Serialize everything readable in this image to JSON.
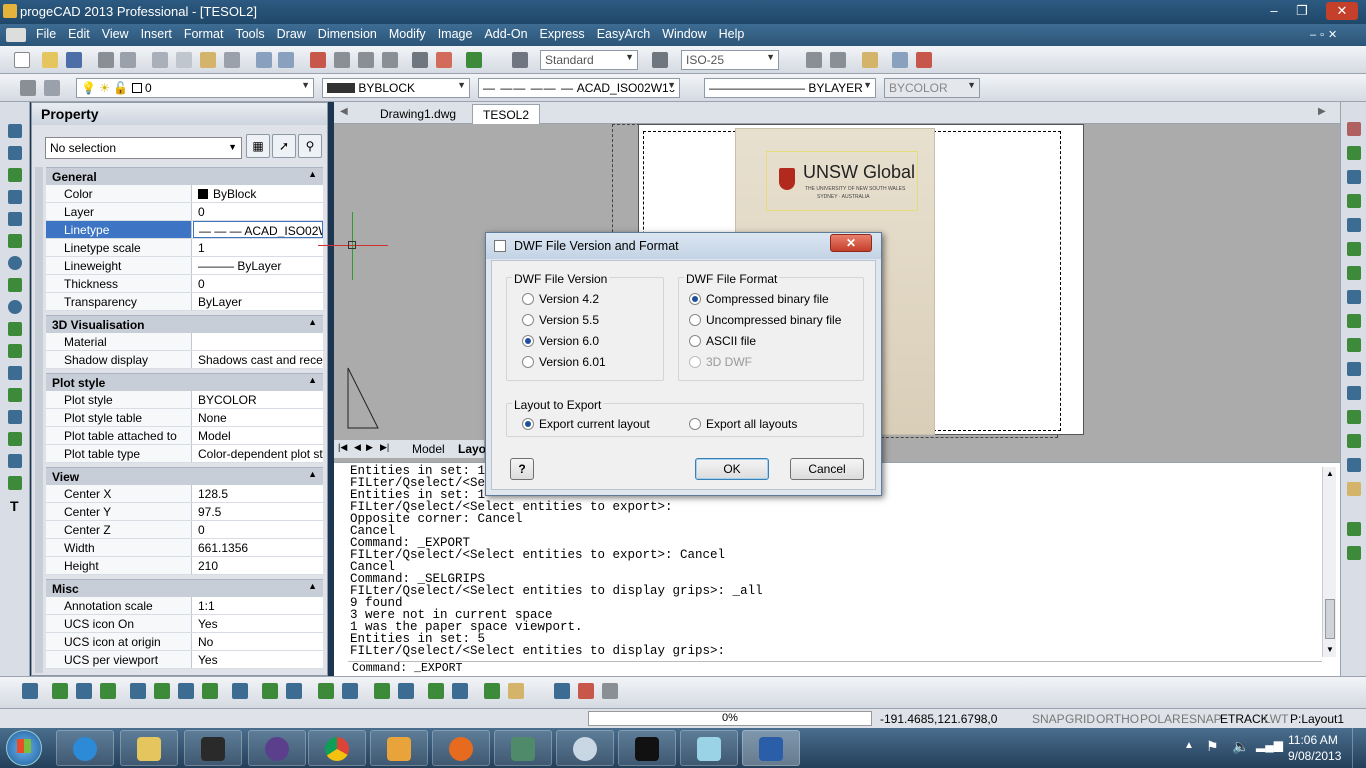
{
  "window": {
    "title": "progeCAD 2013 Professional - [TESOL2]",
    "min": "–",
    "restore": "❐",
    "close": "✕"
  },
  "menu": [
    "File",
    "Edit",
    "View",
    "Insert",
    "Format",
    "Tools",
    "Draw",
    "Dimension",
    "Modify",
    "Image",
    "Add-On",
    "Express",
    "EasyArch",
    "Window",
    "Help"
  ],
  "toolbar": {
    "text_style": "Standard",
    "dim_style": "ISO-25"
  },
  "layer_bar": {
    "layer": "0",
    "color": "BYBLOCK",
    "linetype": "ACAD_ISO02W10",
    "lineweight": "BYLAYER",
    "plotstyle": "BYCOLOR"
  },
  "property": {
    "title": "Property",
    "selection": "No selection",
    "groups": [
      {
        "name": "General",
        "rows": [
          [
            "Color",
            "ByBlock"
          ],
          [
            "Layer",
            "0"
          ],
          [
            "Linetype",
            "ACAD_ISO02W..."
          ],
          [
            "Linetype scale",
            "1"
          ],
          [
            "Lineweight",
            "ByLayer"
          ],
          [
            "Thickness",
            "0"
          ],
          [
            "Transparency",
            "ByLayer"
          ]
        ]
      },
      {
        "name": "3D Visualisation",
        "rows": [
          [
            "Material",
            ""
          ],
          [
            "Shadow display",
            "Shadows cast and recei..."
          ]
        ]
      },
      {
        "name": "Plot style",
        "rows": [
          [
            "Plot style",
            "BYCOLOR"
          ],
          [
            "Plot style table",
            "None"
          ],
          [
            "Plot table attached to",
            "Model"
          ],
          [
            "Plot table type",
            "Color-dependent plot style"
          ]
        ]
      },
      {
        "name": "View",
        "rows": [
          [
            "Center X",
            "128.5"
          ],
          [
            "Center Y",
            "97.5"
          ],
          [
            "Center Z",
            "0"
          ],
          [
            "Width",
            "661.1356"
          ],
          [
            "Height",
            "210"
          ]
        ]
      },
      {
        "name": "Misc",
        "rows": [
          [
            "Annotation scale",
            "1:1"
          ],
          [
            "UCS icon On",
            "Yes"
          ],
          [
            "UCS icon at origin",
            "No"
          ],
          [
            "UCS per viewport",
            "Yes"
          ]
        ]
      }
    ]
  },
  "tabs": {
    "t1": "Drawing1.dwg",
    "t2": "TESOL2",
    "model": "Model",
    "layout": "Layout1"
  },
  "cert": {
    "brand": "UNSW Global",
    "sub": "THE UNIVERSITY OF NEW SOUTH WALES",
    "loc": "SYDNEY · AUSTRALIA"
  },
  "command": {
    "history": "Entities in set: 1\nFILter/Qselect/<Select entities to export>:\nEntities in set: 1\nFILter/Qselect/<Select entities to export>:\nOpposite corner: Cancel\nCancel\nCommand: _EXPORT\nFILter/Qselect/<Select entities to export>: Cancel\nCancel\nCommand: _SELGRIPS\nFILter/Qselect/<Select entities to display grips>: _all\n9 found\n3 were not in current space\n1 was the paper space viewport.\nEntities in set: 5\nFILter/Qselect/<Select entities to display grips>:",
    "prompt": "Command: _EXPORT"
  },
  "status": {
    "progress": "0%",
    "coords": "-191.4685,121.6798,0",
    "toggles": [
      "SNAP",
      "GRID",
      "ORTHO",
      "POLAR",
      "ESNAP",
      "ETRACK",
      "LWT",
      "P:Layout1"
    ]
  },
  "taskbar": {
    "time": "11:06 AM",
    "date": "9/08/2013"
  },
  "dialog": {
    "title": "DWF File Version and Format",
    "close": "✕",
    "version_label": "DWF File Version",
    "versions": [
      "Version 4.2",
      "Version 5.5",
      "Version 6.0",
      "Version 6.01"
    ],
    "version_selected": "Version 6.0",
    "format_label": "DWF File Format",
    "formats": [
      "Compressed binary file",
      "Uncompressed binary file",
      "ASCII file",
      "3D DWF"
    ],
    "format_selected": "Compressed binary file",
    "layout_label": "Layout to Export",
    "layout_current": "Export current layout",
    "layout_all": "Export all layouts",
    "help": "?",
    "ok": "OK",
    "cancel": "Cancel"
  },
  "colors": {
    "accent": "#3d75c4",
    "titlebar": "#1f4768",
    "desktop": "#1c3550",
    "close_red": "#c4402b"
  }
}
